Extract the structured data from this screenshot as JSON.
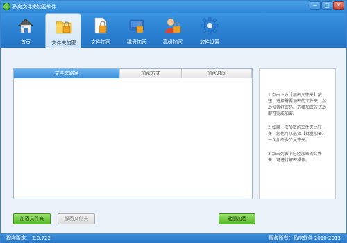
{
  "window": {
    "title": "私房文件夹加密软件",
    "minimize": "−",
    "restore": "▢",
    "close": "✕"
  },
  "toolbar": {
    "items": [
      {
        "label": "首页",
        "icon": "house-icon"
      },
      {
        "label": "文件夹加密",
        "icon": "folder-lock-icon"
      },
      {
        "label": "文件加密",
        "icon": "file-lock-icon"
      },
      {
        "label": "磁盘加密",
        "icon": "disk-lock-icon"
      },
      {
        "label": "高级加密",
        "icon": "user-lock-icon"
      },
      {
        "label": "软件设置",
        "icon": "gear-icon"
      }
    ],
    "active_index": 1
  },
  "table": {
    "headers": [
      "文件夹路径",
      "加密方式",
      "加密时间"
    ],
    "rows": []
  },
  "help": {
    "paragraphs": [
      "1.点击下方【加密文件夹】按钮，选择需要加密的文件夹，然后设置好密码。选择加密方式后即可完成加密。",
      "2.如果一次加密的文件夹比较多，您也可以选择【批量加密】一次加密多个文件夹。",
      "3.双击列表中已经加密的文件夹，可进行解密操作。"
    ]
  },
  "buttons": {
    "encrypt_folder": "加密文件夹",
    "decrypt_folder": "解密文件夹",
    "batch_encrypt": "批量加密"
  },
  "status": {
    "version": "程序版本：  2.0.722",
    "copyright": "版权所有：私房软件 2010-2013"
  },
  "colors": {
    "accent": "#2f86d6",
    "button_green": "#57b82a"
  }
}
